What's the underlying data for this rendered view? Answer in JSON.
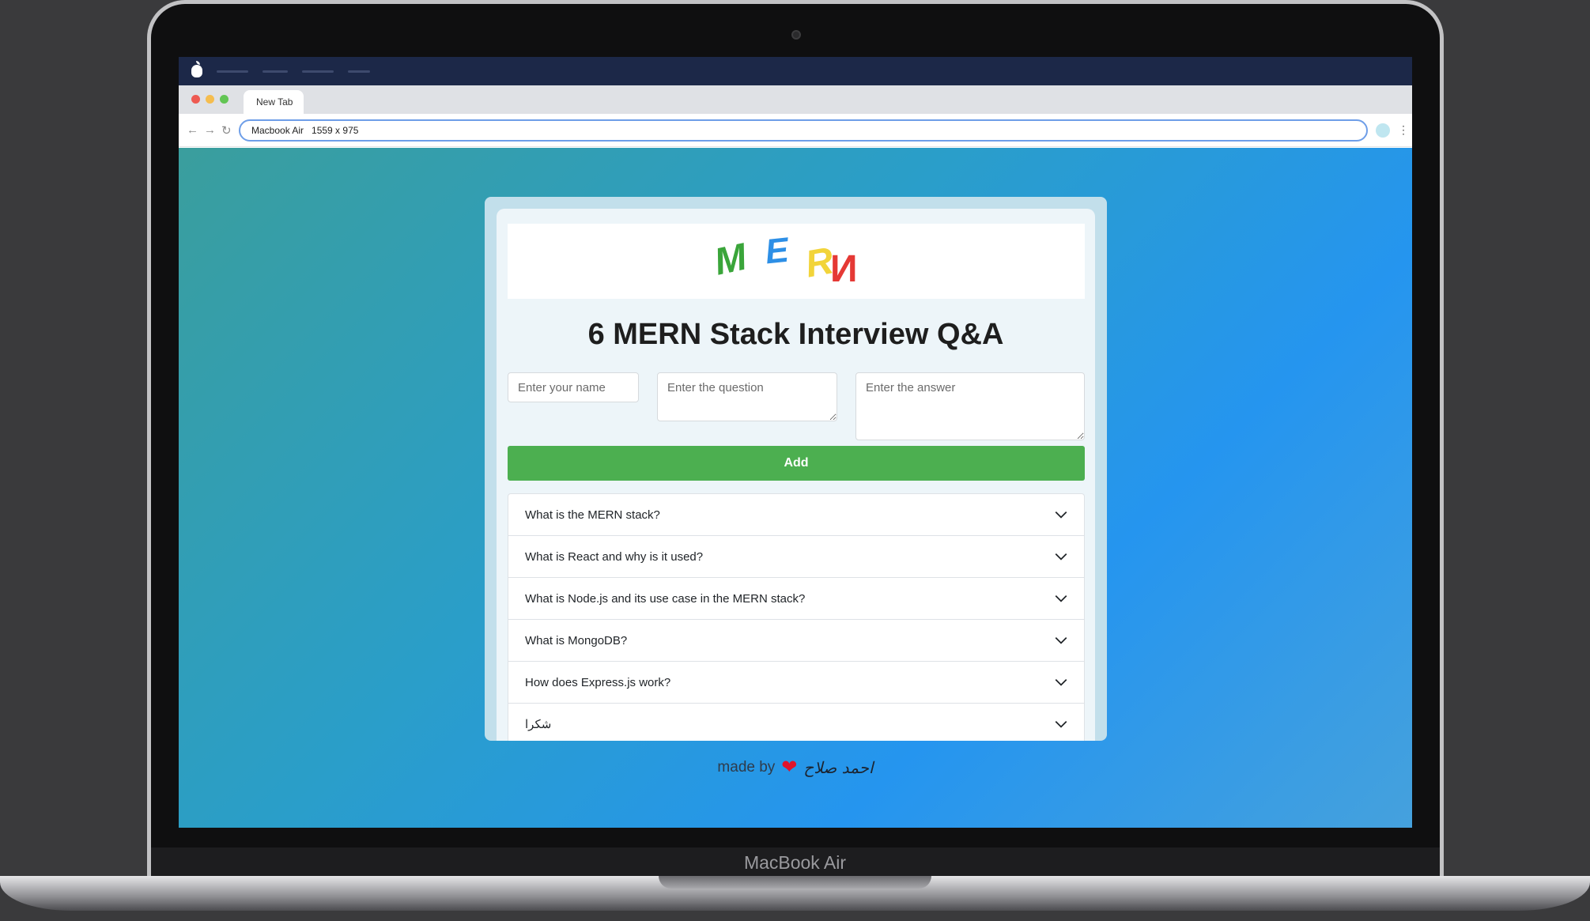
{
  "device": {
    "label": "MacBook Air"
  },
  "browser": {
    "tab_title": "New Tab",
    "url": "Macbook Air   1559 x 975",
    "traffic_colors": [
      "#ee5a52",
      "#f5bd4f",
      "#62c554"
    ]
  },
  "app": {
    "logo_letters": [
      {
        "char": "M",
        "color": "#3aa53a"
      },
      {
        "char": "E",
        "color": "#2d8fe6"
      },
      {
        "char": "R",
        "color": "#f2d43a"
      },
      {
        "char": "И",
        "color": "#e53935"
      }
    ],
    "title": "6 MERN Stack Interview Q&A",
    "form": {
      "name_placeholder": "Enter your name",
      "question_placeholder": "Enter the question",
      "answer_placeholder": "Enter the answer",
      "add_label": "Add"
    },
    "faqs": [
      "What is the MERN stack?",
      "What is React and why is it used?",
      "What is Node.js and its use case in the MERN stack?",
      "What is MongoDB?",
      "How does Express.js work?",
      "شكرا"
    ],
    "footer": {
      "made_by": "made by",
      "heart": "❤",
      "signature": "احمد صلاح"
    }
  },
  "colors": {
    "accent_green": "#4caf50",
    "os_bar": "#1c2848"
  }
}
